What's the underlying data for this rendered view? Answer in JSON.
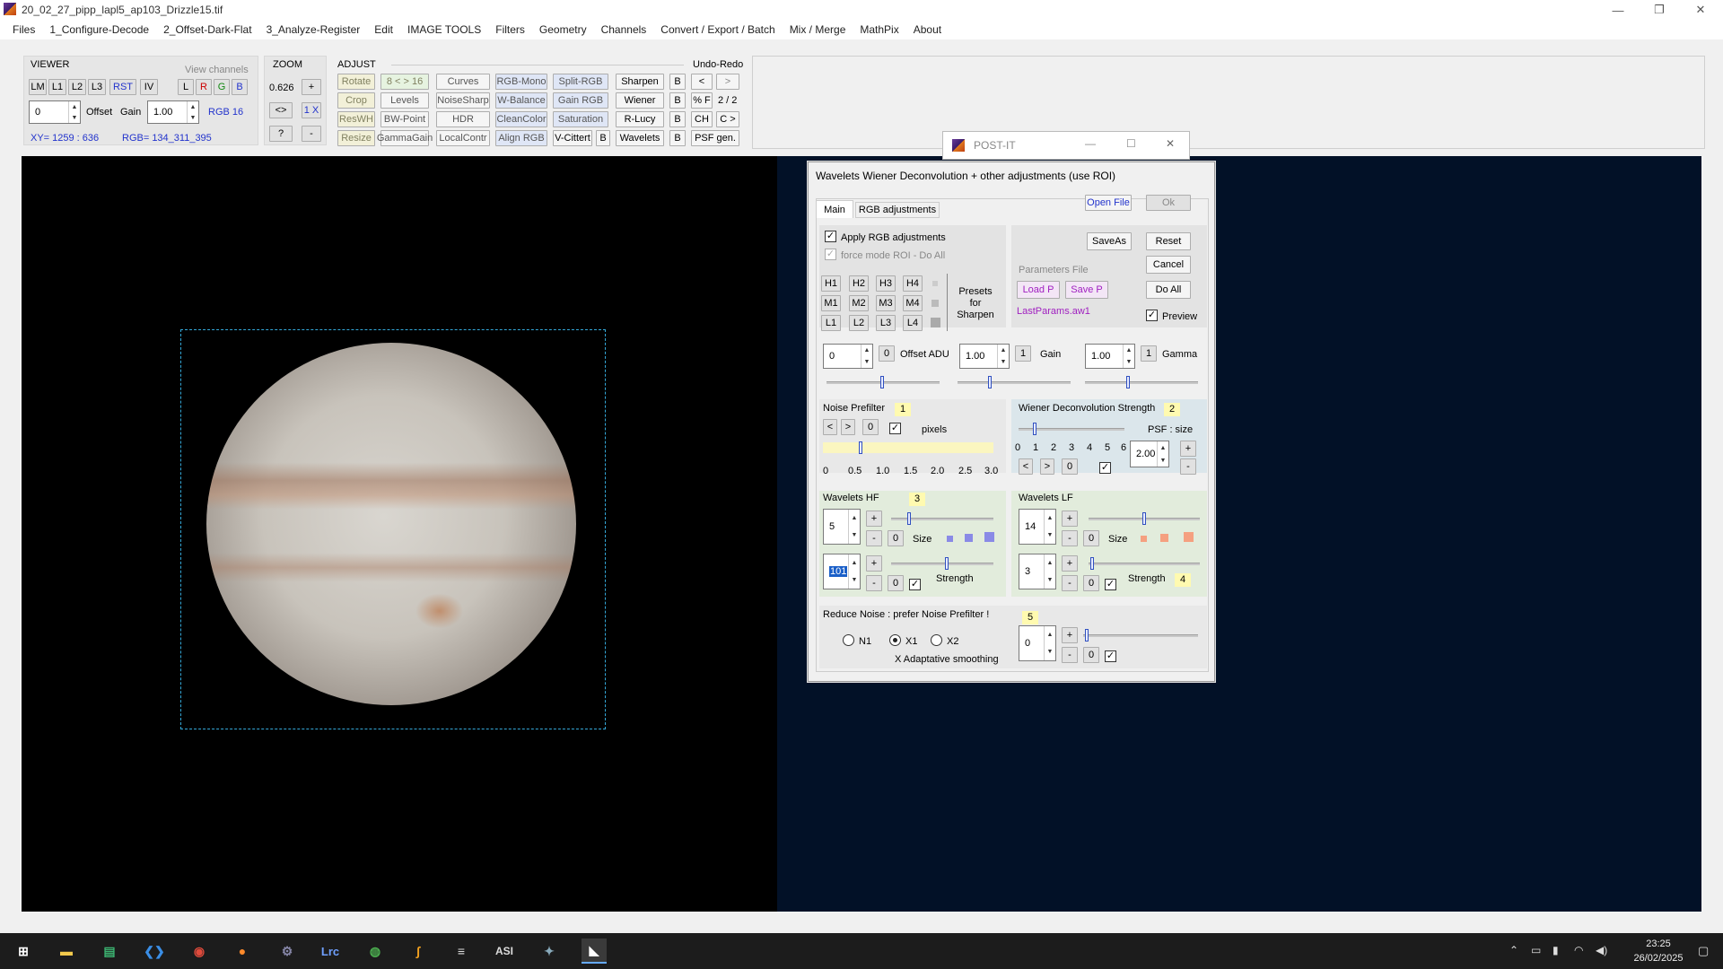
{
  "window": {
    "title": "20_02_27_pipp_lapl5_ap103_Drizzle15.tif"
  },
  "menu": [
    "Files",
    "1_Configure-Decode",
    "2_Offset-Dark-Flat",
    "3_Analyze-Register",
    "Edit",
    "IMAGE TOOLS",
    "Filters",
    "Geometry",
    "Channels",
    "Convert / Export / Batch",
    "Mix / Merge",
    "MathPix",
    "About"
  ],
  "viewer": {
    "title": "VIEWER",
    "view_channels": "View channels",
    "btns": [
      "LM",
      "L1",
      "L2",
      "L3",
      "RST",
      "IV"
    ],
    "ch": [
      "L",
      "R",
      "G",
      "B"
    ],
    "offset_val": "0",
    "offset_lbl": "Offset",
    "gain_lbl": "Gain",
    "gain_val": "1.00",
    "rgb16": "RGB 16",
    "xy": "XY=  1259 : 636",
    "rgb": "RGB=  134_311_395"
  },
  "zoom": {
    "title": "ZOOM",
    "value": "0.626",
    "plus": "+",
    "fit": "<>",
    "one": "1 X",
    "q": "?",
    "minus": "-"
  },
  "adjust": {
    "title": "ADJUST",
    "undo_redo": "Undo-Redo",
    "row1": [
      "Rotate",
      "8 < > 16",
      "Curves",
      "RGB-Mono",
      "Split-RGB",
      "Sharpen",
      "B",
      "<",
      ">"
    ],
    "row2": [
      "Crop",
      "Levels",
      "NoiseSharp",
      "W-Balance",
      "Gain RGB",
      "Wiener",
      "B",
      "% F",
      "2 / 2"
    ],
    "row3": [
      "ResWH",
      "BW-Point",
      "HDR",
      "CleanColor",
      "Saturation",
      "R-Lucy",
      "B",
      "CH",
      "C >"
    ],
    "row4": [
      "Resize",
      "GammaGain",
      "LocalContr",
      "Align RGB",
      "V-Cittert",
      "B",
      "Wavelets",
      "B",
      "PSF gen."
    ]
  },
  "postit": {
    "title": "POST-IT"
  },
  "dialog": {
    "title": "Wavelets Wiener Deconvolution + other adjustments   (use ROI)",
    "tab_main": "Main",
    "tab_rgb": "RGB adjustments",
    "open_file": "Open File",
    "ok": "Ok",
    "apply_rgb": "Apply RGB adjustments",
    "force_mode": "force mode  ROI - Do All",
    "presets_h": [
      "H1",
      "H2",
      "H3",
      "H4"
    ],
    "presets_m": [
      "M1",
      "M2",
      "M3",
      "M4"
    ],
    "presets_l": [
      "L1",
      "L2",
      "L3",
      "L4"
    ],
    "presets_label": "Presets for Sharpen",
    "saveas": "SaveAs",
    "reset": "Reset",
    "cancel": "Cancel",
    "params_file": "Parameters File",
    "load_p": "Load P",
    "save_p": "Save P",
    "do_all": "Do All",
    "last_params": "LastParams.aw1",
    "preview": "Preview",
    "offset_val": "0",
    "offset_zero": "0",
    "offset_lbl": "Offset ADU",
    "gain_val": "1.00",
    "gain_one": "1",
    "gain_lbl": "Gain",
    "gamma_val": "1.00",
    "gamma_one": "1",
    "gamma_lbl": "Gamma",
    "noise_prefilter": "Noise Prefilter",
    "np_badge": "1",
    "np_lt": "<",
    "np_gt": ">",
    "np_zero": "0",
    "pixels": "pixels",
    "np_ticks": [
      "0",
      "0.5",
      "1.0",
      "1.5",
      "2.0",
      "2.5",
      "3.0"
    ],
    "wiener": "Wiener Deconvolution Strength",
    "w_badge": "2",
    "psf_size": "PSF : size",
    "w_ticks": [
      "0",
      "1",
      "2",
      "3",
      "4",
      "5",
      "6"
    ],
    "w_lt": "<",
    "w_gt": ">",
    "w_zero": "0",
    "psf_val": "2.00",
    "psf_plus": "+",
    "psf_minus": "-",
    "whf": "Wavelets HF",
    "whf_badge": "3",
    "whf_size_val": "5",
    "whf_str_val": "101",
    "size": "Size",
    "strength": "Strength",
    "plus": "+",
    "minus": "-",
    "zero": "0",
    "wlf": "Wavelets LF",
    "wlf_size_val": "14",
    "wlf_str_val": "3",
    "wlf_badge": "4",
    "reduce_noise": "Reduce Noise :  prefer Noise Prefilter !",
    "rn_badge": "5",
    "n1": "N1",
    "x1": "X1",
    "x2": "X2",
    "adapt": "X Adaptative smoothing",
    "rn_val": "0"
  },
  "taskbar": {
    "time": "23:25",
    "date": "26/02/2025"
  },
  "colors": {
    "accent": "#2233cc",
    "dark_bg": "#021127",
    "roi": "#34a8d8"
  }
}
